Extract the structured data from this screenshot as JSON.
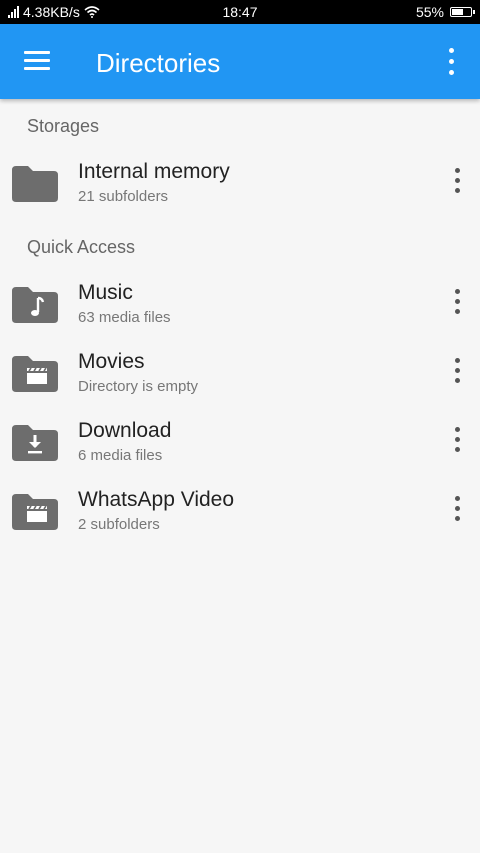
{
  "status_bar": {
    "network_speed": "4.38KB/s",
    "time": "18:47",
    "battery": "55%"
  },
  "app_bar": {
    "title": "Directories"
  },
  "sections": {
    "storages": "Storages",
    "quick_access": "Quick Access"
  },
  "items": [
    {
      "title": "Internal memory",
      "subtitle": "21 subfolders",
      "icon": "folder-icon"
    },
    {
      "title": "Music",
      "subtitle": "63 media files",
      "icon": "music-folder-icon"
    },
    {
      "title": "Movies",
      "subtitle": "Directory is empty",
      "icon": "movie-folder-icon"
    },
    {
      "title": "Download",
      "subtitle": "6 media files",
      "icon": "download-folder-icon"
    },
    {
      "title": "WhatsApp Video",
      "subtitle": "2 subfolders",
      "icon": "movie-folder-icon"
    }
  ],
  "colors": {
    "app_bar": "#2196f3",
    "folder": "#6d6d6d"
  }
}
